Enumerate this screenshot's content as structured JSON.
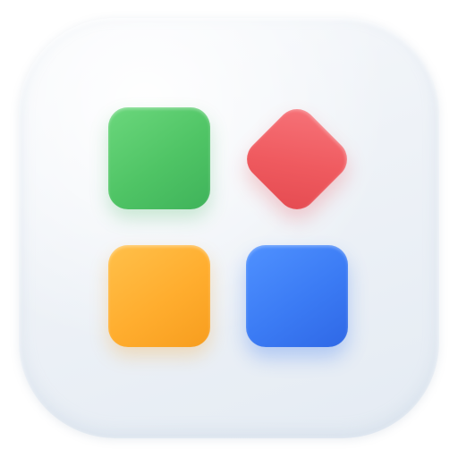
{
  "icon": {
    "name": "apps-grid-icon",
    "background_color": "#eef2f7",
    "tiles": [
      {
        "name": "green-square-tile",
        "shape": "rounded-square",
        "color": "#4fc465"
      },
      {
        "name": "red-diamond-tile",
        "shape": "rounded-diamond",
        "color": "#ef5a5f"
      },
      {
        "name": "orange-square-tile",
        "shape": "rounded-square",
        "color": "#ffad2e"
      },
      {
        "name": "blue-square-tile",
        "shape": "rounded-square",
        "color": "#3b7bf4"
      }
    ]
  }
}
